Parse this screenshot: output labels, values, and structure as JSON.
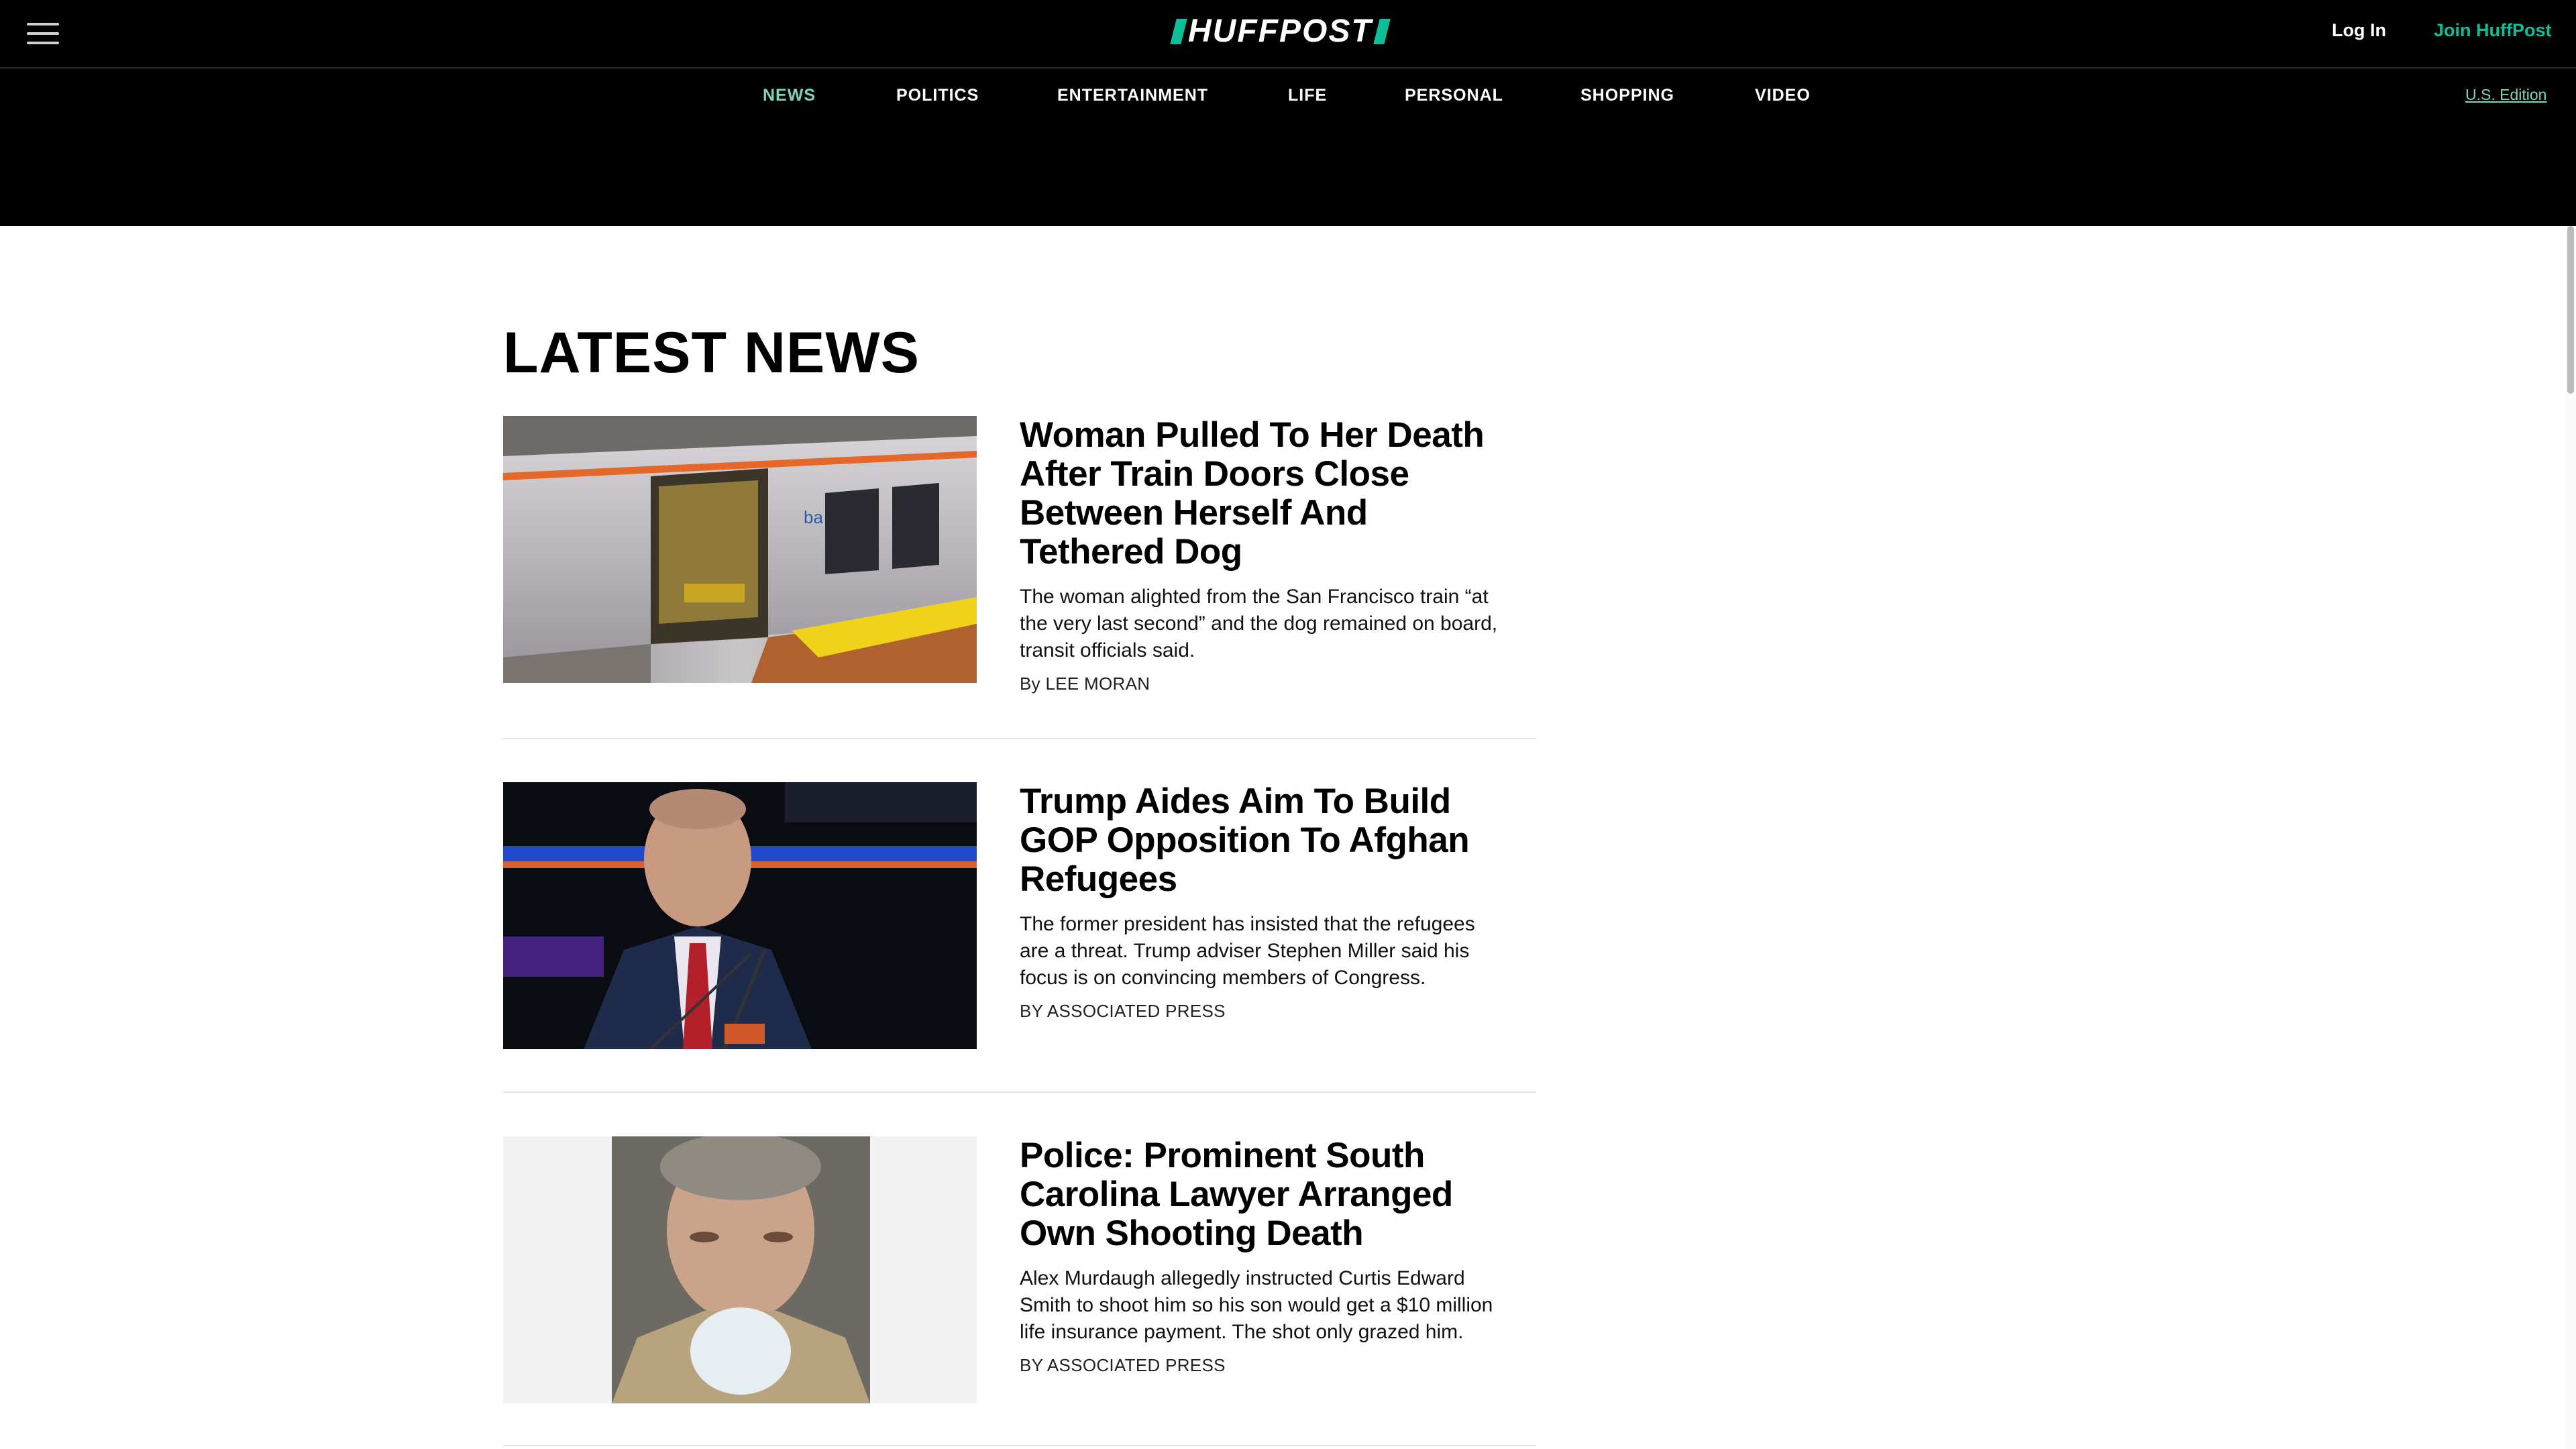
{
  "header": {
    "logo_text": "HUFFPOST",
    "login_label": "Log In",
    "join_label": "Join HuffPost",
    "edition_label": "U.S. Edition",
    "accent_color": "#0dbe98"
  },
  "nav": {
    "items": [
      {
        "label": "NEWS",
        "active": true
      },
      {
        "label": "POLITICS"
      },
      {
        "label": "ENTERTAINMENT"
      },
      {
        "label": "LIFE"
      },
      {
        "label": "PERSONAL"
      },
      {
        "label": "SHOPPING"
      },
      {
        "label": "VIDEO"
      }
    ]
  },
  "main": {
    "section_title": "LATEST NEWS",
    "articles": [
      {
        "headline": "Woman Pulled To Her Death After Train Doors Close Between Herself And Tethered Dog",
        "summary": "The woman alighted from the San Francisco train “at the very last second” and the dog remained on board, transit officials said.",
        "byline": "By LEE MORAN",
        "image": "subway-train-photo"
      },
      {
        "headline": "Trump Aides Aim To Build GOP Opposition To Afghan Refugees",
        "summary": "The former president has insisted that the refugees are a threat. Trump adviser Stephen Miller said his focus is on convincing members of Congress.",
        "byline": "BY ASSOCIATED PRESS",
        "image": "speaker-at-podium-photo"
      },
      {
        "headline": "Police: Prominent South Carolina Lawyer Arranged Own Shooting Death",
        "summary": "Alex Murdaugh allegedly instructed Curtis Edward Smith to shoot him so his son would get a $10 million life insurance payment. The shot only grazed him.",
        "byline": "BY ASSOCIATED PRESS",
        "image": "mugshot-photo"
      }
    ]
  }
}
